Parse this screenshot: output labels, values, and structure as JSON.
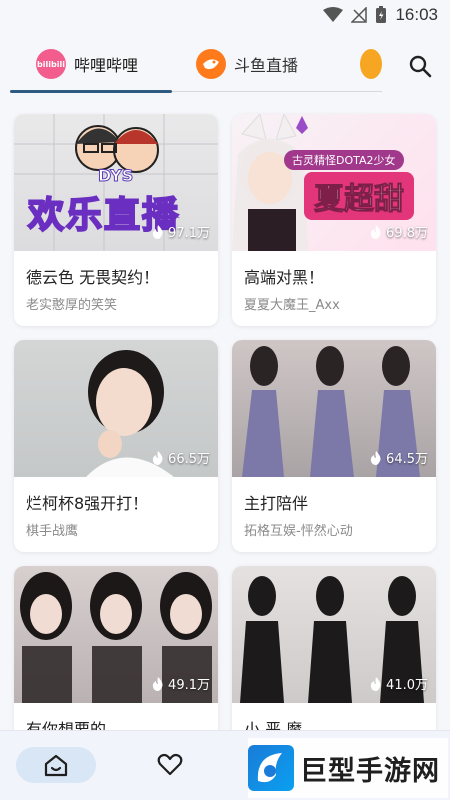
{
  "status_bar": {
    "time": "16:03"
  },
  "tabs": [
    {
      "label": "哔哩哔哩",
      "icon": "bilibili-icon",
      "icon_text": "bilibili",
      "color": "#f25d8e",
      "active": true
    },
    {
      "label": "斗鱼直播",
      "icon": "douyu-icon",
      "color": "#ff7a1a",
      "active": false
    }
  ],
  "search": {
    "icon": "search-icon"
  },
  "cards": [
    {
      "title": "德云色 无畏契约！",
      "streamer": "老实憨厚的笑笑",
      "viewers": "97.1万",
      "thumb_text": "欢乐直播",
      "thumb_text2": "DYS"
    },
    {
      "title": "高端对黑！",
      "streamer": "夏夏大魔王_Axx",
      "viewers": "69.8万",
      "thumb_text": "夏超甜",
      "thumb_text2": "古灵精怪DOTA2少女"
    },
    {
      "title": "烂柯杯8强开打！",
      "streamer": "棋手战鹰",
      "viewers": "66.5万"
    },
    {
      "title": "主打陪伴",
      "streamer": "拓格互娱-怦然心动",
      "viewers": "64.5万"
    },
    {
      "title": "有你想要的",
      "streamer": "",
      "viewers": "49.1万"
    },
    {
      "title": "小 恶 魔",
      "streamer": "",
      "viewers": "41.0万"
    }
  ],
  "bottom_nav": {
    "home_icon": "home-icon",
    "favorites_icon": "heart-icon"
  },
  "watermark": {
    "text": "巨型手游网"
  }
}
